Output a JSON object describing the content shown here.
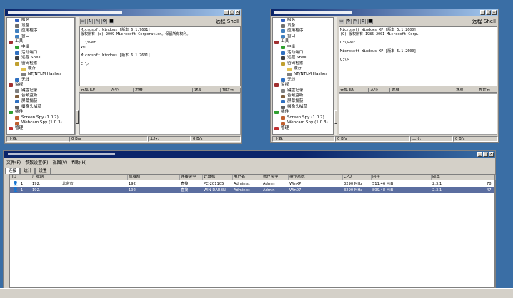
{
  "window1": {
    "tree": [
      "服务",
      "设备",
      "应用程序",
      "窗口",
      "工具",
      "中继",
      "活动端口",
      "远程 Shell",
      "密码检索",
      "缓存",
      "NT/NTLM Hashes",
      "无线",
      "监视",
      "键盘记录",
      "音频监听",
      "屏幕捕获",
      "摄像头捕获",
      "插件",
      "Screen Spy (1.0.7)",
      "Webcam Spy (1.0.3)",
      "管理"
    ],
    "tool_title": "远程 Shell",
    "shell": [
      "Microsoft Windows [版本 6.1.7601]",
      "版权所有 (c) 2009 Microsoft Corporation。保留所有权利。",
      "",
      "C:\\>ver",
      "ver",
      "",
      "Microsoft Windows [版本 6.1.7601]",
      "",
      "C:\\>"
    ],
    "cols": [
      "完成 ID/",
      "大小",
      "进展",
      "速度",
      "预计完"
    ],
    "status": [
      "下载:",
      "0 B/s",
      "上传:",
      "0 B/s"
    ]
  },
  "window2": {
    "tree": [
      "服务",
      "设备",
      "应用程序",
      "窗口",
      "工具",
      "中继",
      "活动端口",
      "远程 Shell",
      "密码检索",
      "缓存",
      "NT/NTLM Hashes",
      "无线",
      "监视",
      "键盘记录",
      "音频监听",
      "屏幕捕获",
      "摄像头捕获",
      "插件",
      "Screen Spy (1.0.7)",
      "Webcam Spy (1.0.3)",
      "管理"
    ],
    "tool_title": "远程 Shell",
    "shell": [
      "Microsoft Windows XP [版本 5.1.2600]",
      "(C) 版权所有 1985-2001 Microsoft Corp.",
      "",
      "C:\\>ver",
      "",
      "Microsoft Windows XP [版本 5.1.2600]",
      "",
      "C:\\>"
    ],
    "cols": [
      "完成 ID/",
      "大小",
      "进展",
      "速度",
      "预计完"
    ],
    "status": [
      "下载:",
      "0 B/s",
      "上传:",
      "0 B/s"
    ]
  },
  "main": {
    "menu": [
      "文件(F)",
      "参数设置(P)",
      "视图(V)",
      "帮助(H)"
    ],
    "tabs": [
      "连接",
      "统计",
      "设置"
    ],
    "columns": [
      "ID",
      "广域网",
      "局域网",
      "连接类型",
      "计算机",
      "用户名",
      "账户类型",
      "操作系统",
      "CPU",
      "内存",
      "版本",
      ""
    ],
    "rows": [
      [
        "1",
        "192.",
        "北京市",
        "192.",
        "直接",
        "PC-201105",
        "Administ",
        "Admin",
        "WinXP",
        "3290 MHz",
        "511.46 MiB",
        "2.3.1",
        "78"
      ],
      [
        "1",
        "192.",
        "",
        "192.",
        "直接",
        "WIN-DARBN",
        "Administ",
        "Admin",
        "Win07",
        "3290 MHz",
        "899.48 MiB",
        "2.3.1",
        "47"
      ]
    ]
  }
}
